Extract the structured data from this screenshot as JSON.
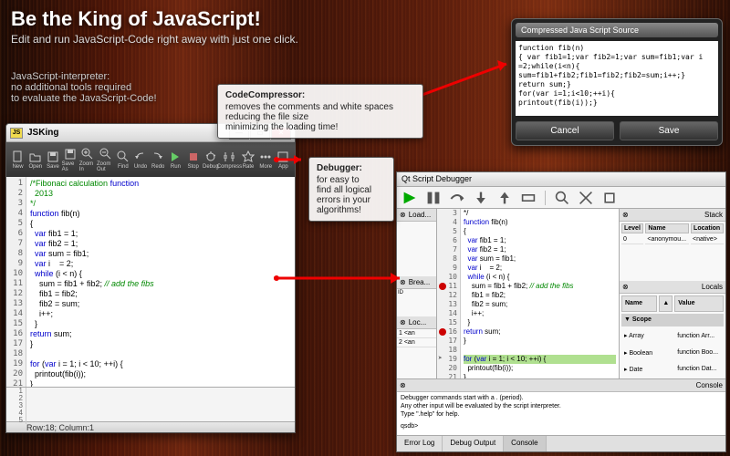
{
  "hero": {
    "title": "Be the King of JavaScript!",
    "subtitle": "Edit and run JavaScript-Code right away with just one click."
  },
  "subhero": {
    "l1": "JavaScript-interpreter:",
    "l2": "no additional tools required",
    "l3": "to evaluate the JavaScript-Code!"
  },
  "callout1": {
    "title": "CodeCompressor:",
    "l1": "removes the comments and white spaces",
    "l2": "reducing the file size",
    "l3": "minimizing the loading time!"
  },
  "callout2": {
    "title": "Debugger:",
    "l1": "for easy to",
    "l2": "find all logical",
    "l3": "errors in your",
    "l4": "algorithms!"
  },
  "jsking": {
    "app_badge": "JS",
    "title": "JSKing",
    "toolbar": [
      "New",
      "Open",
      "Save",
      "Save As",
      "Zoom In",
      "Zoom Out",
      "Find",
      "Undo",
      "Redo",
      "Run",
      "Stop",
      "Debug",
      "Compress",
      "Rate",
      "More",
      "App"
    ],
    "code": [
      "/*Fibonaci calculation function",
      "  2013",
      "*/",
      "function fib(n)",
      "{",
      "  var fib1 = 1;",
      "  var fib2 = 1;",
      "  var sum = fib1;",
      "  var i    = 2;",
      "  while (i < n) {",
      "    sum = fib1 + fib2; // add the fibs",
      "    fib1 = fib2;",
      "    fib2 = sum;",
      "    i++;",
      "  }",
      "return sum;",
      "}",
      "",
      "for (var i = 1; i < 10; ++i) {",
      "  printout(fib(i));",
      "}"
    ],
    "status": "Row:18; Column:1"
  },
  "compress": {
    "title": "Compressed Java Script Source",
    "lines": [
      "function fib(n)",
      "{ var fib1=1;var fib2=1;var sum=fib1;var i =2;while(i<n){",
      " sum=fib1+fib2;fib1=fib2;fib2=sum;i++;}",
      " return sum;}",
      " for(var i=1;i<10;++i){",
      " printout(fib(i));}"
    ],
    "cancel": "Cancel",
    "save": "Save"
  },
  "debugger": {
    "title": "Qt Script Debugger",
    "left_panels": {
      "load": "Load...",
      "brea": "Brea...",
      "loc": "Loc..."
    },
    "loc_rows": [
      {
        "id": "1",
        "name": "<an"
      },
      {
        "id": "2",
        "name": "<an"
      }
    ],
    "code": [
      "*/",
      "function fib(n)",
      "{",
      "  var fib1 = 1;",
      "  var fib2 = 1;",
      "  var sum = fib1;",
      "  var i    = 2;",
      "  while (i < n) {",
      "    sum = fib1 + fib2; // add the fibs",
      "    fib1 = fib2;",
      "    fib2 = sum;",
      "    i++;",
      "  }",
      "return sum;",
      "}",
      "",
      "for (var i = 1; i < 10; ++i) {",
      "  printout(fib(i));",
      "}"
    ],
    "code_start": 3,
    "stack": {
      "title": "Stack",
      "cols": [
        "Level",
        "Name",
        "Location"
      ],
      "row": [
        "0",
        "<anonymou...",
        "<native>"
      ]
    },
    "locals": {
      "title": "Locals",
      "cols": [
        "Name",
        "",
        "Value"
      ],
      "scope": "Scope",
      "rows": [
        [
          "Array",
          "function Arr..."
        ],
        [
          "Boolean",
          "function Boo..."
        ],
        [
          "Date",
          "function Dat..."
        ]
      ]
    },
    "console": {
      "title": "Console",
      "l1": "Debugger commands start with a . (period).",
      "l2": "Any other input will be evaluated by the script interpreter.",
      "l3": "Type \".help\" for help.",
      "prompt": "qsdb>"
    },
    "tabs": [
      "Error Log",
      "Debug Output",
      "Console"
    ]
  }
}
